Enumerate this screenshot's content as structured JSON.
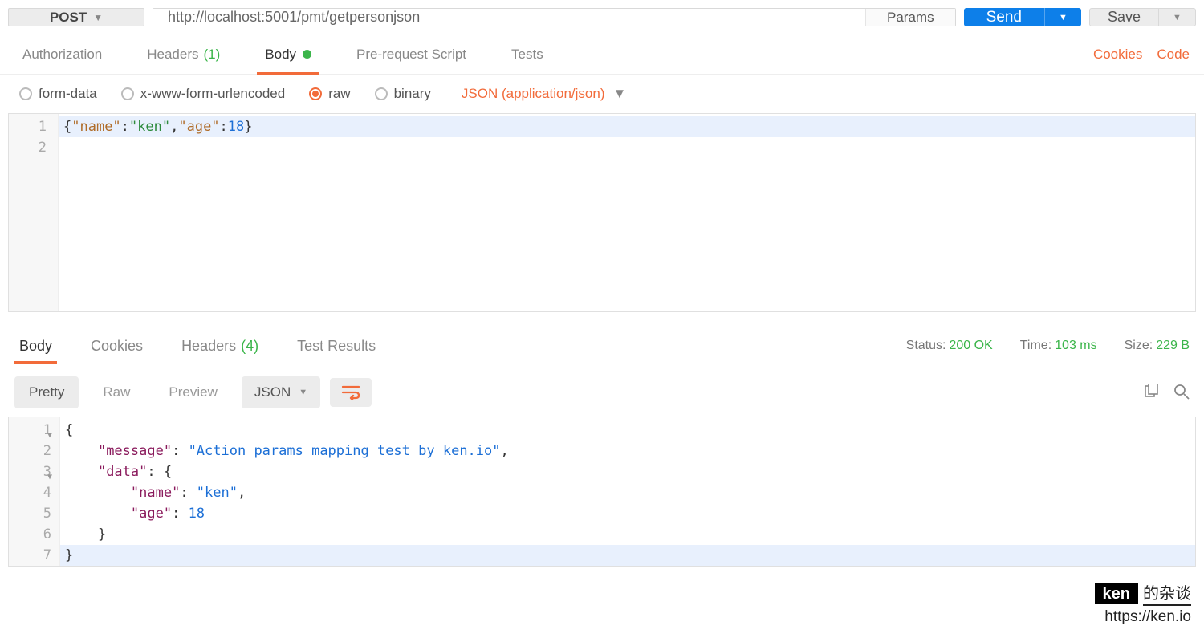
{
  "toolbar": {
    "method": "POST",
    "url": "http://localhost:5001/pmt/getpersonjson",
    "params_label": "Params",
    "send_label": "Send",
    "save_label": "Save"
  },
  "tabs": {
    "authorization": "Authorization",
    "headers": "Headers",
    "headers_count": "(1)",
    "body": "Body",
    "prerequest": "Pre-request Script",
    "tests": "Tests",
    "cookies_link": "Cookies",
    "code_link": "Code"
  },
  "body_options": {
    "formdata": "form-data",
    "xwww": "x-www-form-urlencoded",
    "raw": "raw",
    "binary": "binary",
    "content_type": "JSON (application/json)"
  },
  "request_body": {
    "line1_gutter": "1",
    "line2_gutter": "2",
    "raw_text": "{\"name\":\"ken\",\"age\":18}"
  },
  "response_tabs": {
    "body": "Body",
    "cookies": "Cookies",
    "headers": "Headers",
    "headers_count": "(4)",
    "test_results": "Test Results"
  },
  "response_meta": {
    "status_label": "Status:",
    "status_value": "200 OK",
    "time_label": "Time:",
    "time_value": "103 ms",
    "size_label": "Size:",
    "size_value": "229 B"
  },
  "response_toolbar": {
    "pretty": "Pretty",
    "raw": "Raw",
    "preview": "Preview",
    "format": "JSON"
  },
  "response_body": {
    "gutter": [
      "1",
      "2",
      "3",
      "4",
      "5",
      "6",
      "7"
    ],
    "json": {
      "message": "Action params mapping test by ken.io",
      "data": {
        "name": "ken",
        "age": 18
      }
    }
  },
  "watermark": {
    "badge": "ken",
    "rest": "的杂谈",
    "url": "https://ken.io"
  }
}
